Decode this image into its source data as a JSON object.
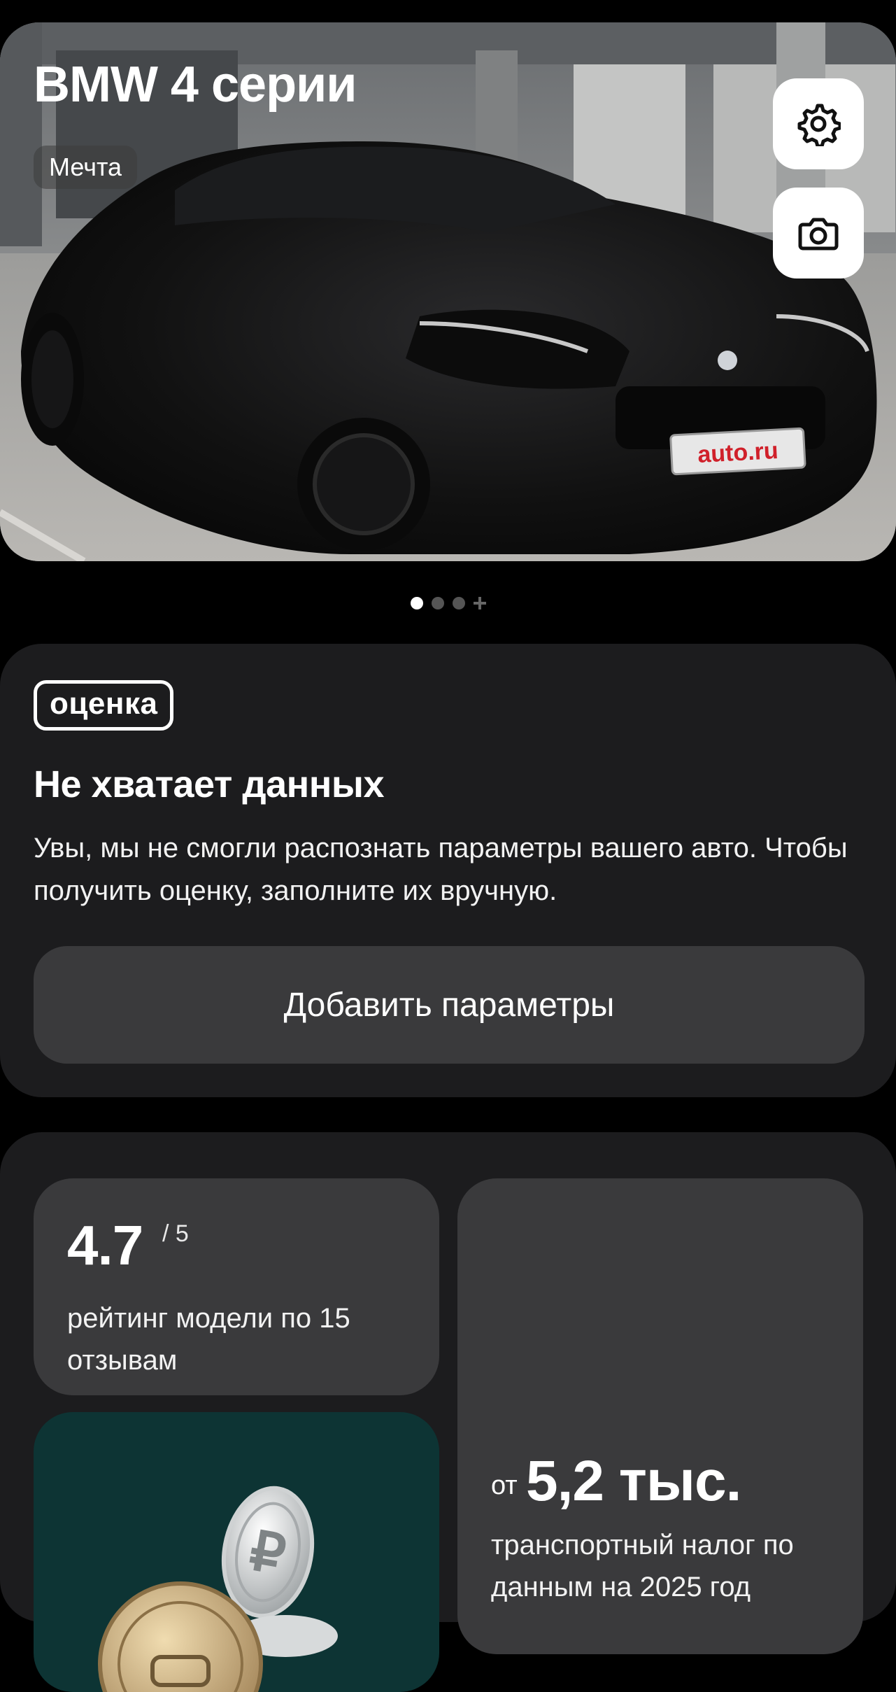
{
  "hero": {
    "title": "BMW 4 серии",
    "tag": "Мечта",
    "plate_text": "auto.ru",
    "settings_icon": "gear-icon",
    "camera_icon": "camera-icon"
  },
  "pager": {
    "total_dots": 3,
    "active_index": 0,
    "has_add": true
  },
  "valuation": {
    "badge": "оценка",
    "title": "Не хватает данных",
    "text": "Увы, мы не смогли распознать параметры вашего авто. Чтобы получить оценку, заполните их вручную.",
    "button_label": "Добавить параметры"
  },
  "rating": {
    "value": "4.7",
    "max": "/ 5",
    "text": "рейтинг модели по 15 отзывам"
  },
  "tax": {
    "prefix": "от",
    "value": "5,2 тыс.",
    "text": "транспортный налог по данным на 2025 год"
  },
  "promo": {
    "icon": "ruble-coins-icon"
  },
  "colors": {
    "background": "#000000",
    "card": "#1c1c1e",
    "tile": "#3a3a3c",
    "promo_tile": "#0d3434",
    "plate_text": "#d0202a"
  }
}
